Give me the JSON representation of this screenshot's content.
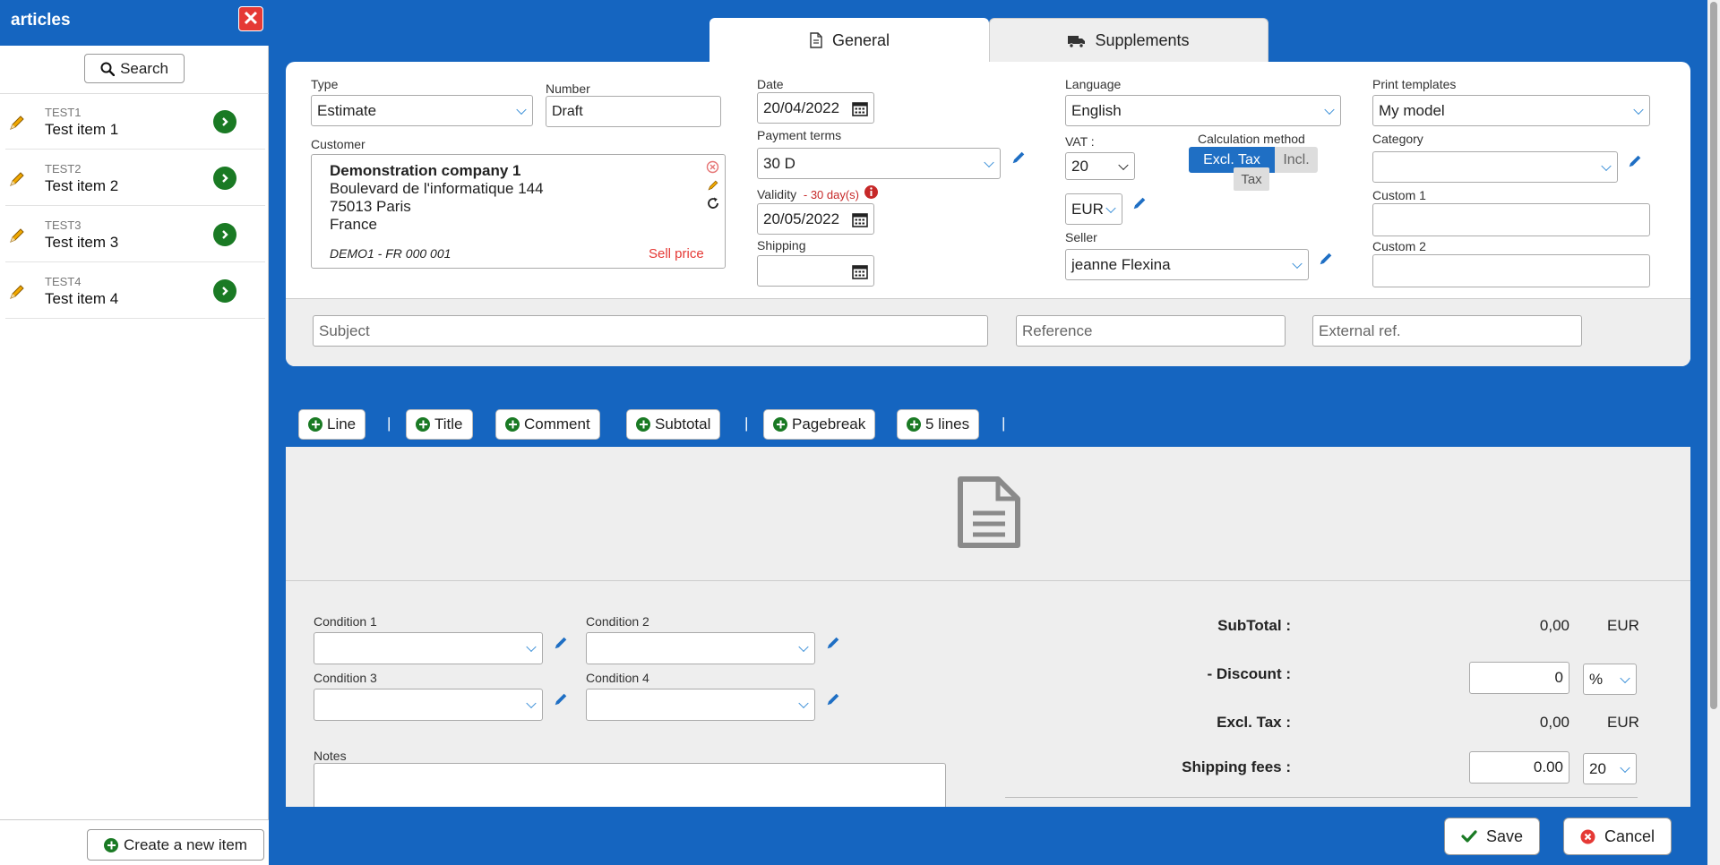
{
  "sidebar": {
    "title": "articles",
    "close_icon": "close-icon",
    "search_label": "Search",
    "items": [
      {
        "code": "TEST1",
        "name": "Test item 1"
      },
      {
        "code": "TEST2",
        "name": "Test item 2"
      },
      {
        "code": "TEST3",
        "name": "Test item 3"
      },
      {
        "code": "TEST4",
        "name": "Test item 4"
      }
    ],
    "create_label": "Create a new item"
  },
  "tabs": {
    "general": "General",
    "supplements": "Supplements"
  },
  "form": {
    "type": {
      "label": "Type",
      "value": "Estimate"
    },
    "number": {
      "label": "Number",
      "value": "Draft"
    },
    "customer": {
      "label": "Customer",
      "name": "Demonstration company 1",
      "address1": "Boulevard de l'informatique 144",
      "address2": "75013 Paris",
      "country": "France",
      "code": "DEMO1 - FR 000 001",
      "price_type": "Sell price"
    },
    "date": {
      "label": "Date",
      "value": "20/04/2022"
    },
    "payment_terms": {
      "label": "Payment terms",
      "value": "30 D"
    },
    "validity": {
      "label": "Validity",
      "note": "- 30 day(s)",
      "value": "20/05/2022"
    },
    "shipping": {
      "label": "Shipping",
      "value": ""
    },
    "language": {
      "label": "Language",
      "value": "English"
    },
    "vat": {
      "label": "VAT :",
      "value": "20"
    },
    "calc_method": {
      "label": "Calculation method",
      "excl": "Excl. Tax",
      "incl": "Incl.",
      "tooltip": "Tax"
    },
    "currency": {
      "value": "EUR"
    },
    "seller": {
      "label": "Seller",
      "value": "jeanne Flexina"
    },
    "print_templates": {
      "label": "Print templates",
      "value": "My model"
    },
    "category": {
      "label": "Category",
      "value": ""
    },
    "custom1": {
      "label": "Custom 1",
      "value": ""
    },
    "custom2": {
      "label": "Custom 2",
      "value": ""
    },
    "subject": {
      "placeholder": "Subject"
    },
    "reference": {
      "placeholder": "Reference"
    },
    "external_ref": {
      "placeholder": "External ref."
    }
  },
  "toolbar": {
    "line": "Line",
    "title": "Title",
    "comment": "Comment",
    "subtotal": "Subtotal",
    "pagebreak": "Pagebreak",
    "five_lines": "5 lines",
    "separator": "|"
  },
  "conditions": {
    "c1": "Condition 1",
    "c2": "Condition 2",
    "c3": "Condition 3",
    "c4": "Condition 4",
    "notes": "Notes"
  },
  "totals": {
    "subtotal_label": "SubTotal :",
    "subtotal_value": "0,00",
    "subtotal_currency": "EUR",
    "discount_label": "- Discount :",
    "discount_value": "0",
    "discount_unit": "%",
    "excl_label": "Excl. Tax :",
    "excl_value": "0,00",
    "excl_currency": "EUR",
    "shipping_label": "Shipping fees :",
    "shipping_value": "0.00",
    "shipping_vat": "20"
  },
  "footer": {
    "save": "Save",
    "cancel": "Cancel"
  },
  "colors": {
    "primary": "#1565c0",
    "accent_green": "#1a7a24",
    "danger": "#e53935"
  }
}
